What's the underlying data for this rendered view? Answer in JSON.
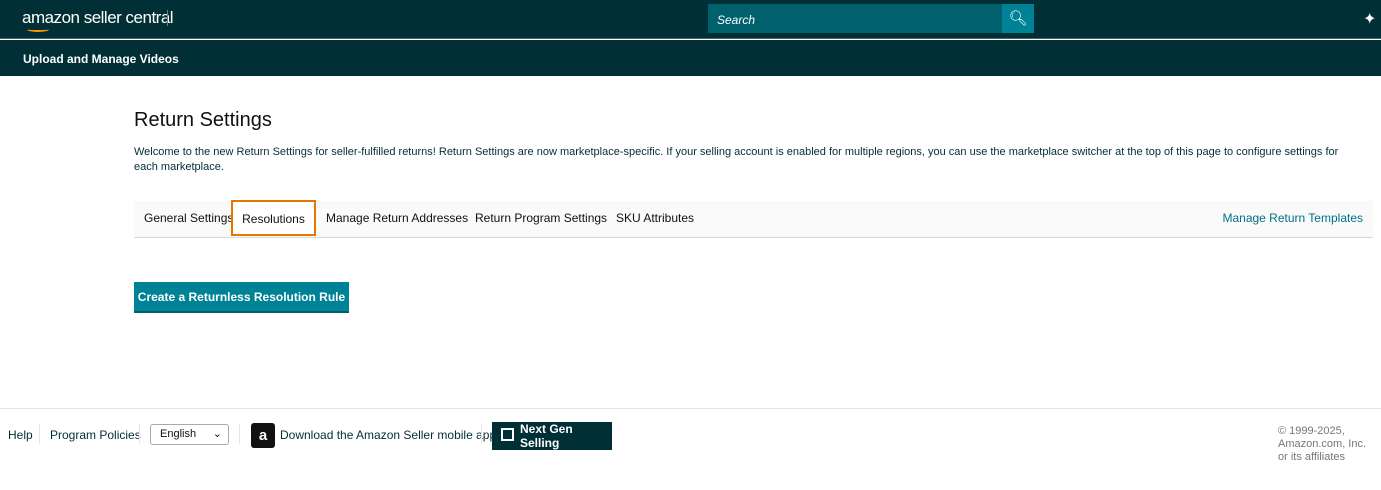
{
  "header": {
    "logo": "amazon seller central",
    "search_placeholder": "Search"
  },
  "subnav": {
    "item": "Upload and Manage Videos"
  },
  "page": {
    "title": "Return Settings",
    "intro": "Welcome to the new Return Settings for seller-fulfilled returns! Return Settings are now marketplace-specific. If your selling account is enabled for multiple regions, you can use the marketplace switcher at the top of this page to configure settings for each marketplace."
  },
  "tabs": [
    {
      "label": "General Settings"
    },
    {
      "label": "Resolutions",
      "selected": true
    },
    {
      "label": "Manage Return Addresses"
    },
    {
      "label": "Return Program Settings"
    },
    {
      "label": "SKU Attributes"
    }
  ],
  "manage_templates": "Manage Return Templates",
  "create_button": "Create a Returnless Resolution Rule",
  "footer": {
    "help": "Help",
    "policies": "Program Policies",
    "language": "English",
    "app": "Download the Amazon Seller mobile app",
    "next_gen": "Next Gen Selling",
    "copyright": "© 1999-2025, Amazon.com, Inc. or its affiliates"
  },
  "colors": {
    "header": "#002f36",
    "accent": "#008296",
    "selected_tab_border": "#e77600"
  }
}
